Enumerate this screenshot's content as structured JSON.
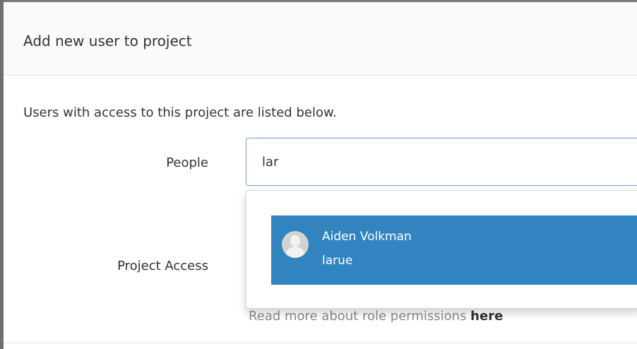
{
  "header": {
    "title": "Add new user to project"
  },
  "body": {
    "intro": "Users with access to this project are listed below.",
    "people_label": "People",
    "people_value": "lar",
    "project_access_label": "Project Access",
    "hint_prefix": "Read more about role permissions ",
    "hint_link": "here"
  },
  "dropdown": {
    "items": [
      {
        "name": "Aiden Volkman",
        "username": "larue"
      }
    ]
  },
  "colors": {
    "selection": "#3184bf",
    "focus_border": "#7ea9d7",
    "text": "#333333",
    "muted_text": "#8a8a8a"
  }
}
